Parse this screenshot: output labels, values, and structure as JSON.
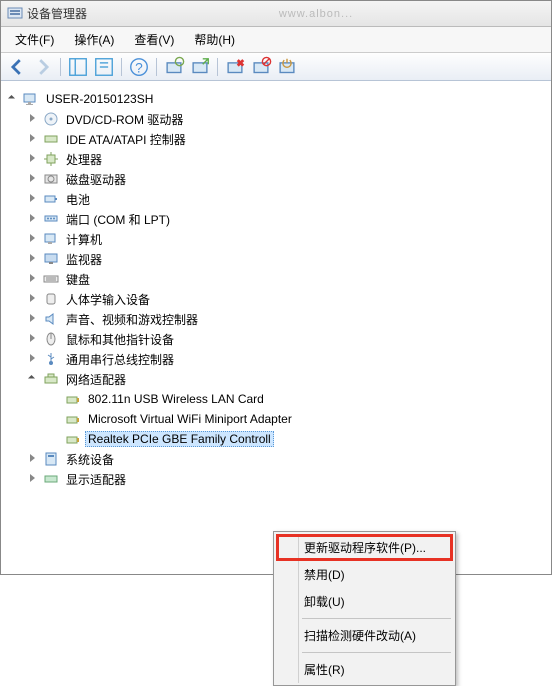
{
  "window": {
    "title": "设备管理器",
    "blur_text": "www.albon..."
  },
  "menu": {
    "file": "文件(F)",
    "action": "操作(A)",
    "view": "查看(V)",
    "help": "帮助(H)"
  },
  "tree": {
    "root": "USER-20150123SH",
    "items": [
      "DVD/CD-ROM 驱动器",
      "IDE ATA/ATAPI 控制器",
      "处理器",
      "磁盘驱动器",
      "电池",
      "端口 (COM 和 LPT)",
      "计算机",
      "监视器",
      "键盘",
      "人体学输入设备",
      "声音、视频和游戏控制器",
      "鼠标和其他指针设备",
      "通用串行总线控制器",
      "网络适配器",
      "系统设备",
      "显示适配器"
    ],
    "net_children": [
      "802.11n USB Wireless LAN Card",
      "Microsoft Virtual WiFi Miniport Adapter",
      "Realtek PCIe GBE Family Controll"
    ]
  },
  "ctx": {
    "update": "更新驱动程序软件(P)...",
    "disable": "禁用(D)",
    "uninstall": "卸载(U)",
    "scan": "扫描检测硬件改动(A)",
    "properties": "属性(R)"
  }
}
